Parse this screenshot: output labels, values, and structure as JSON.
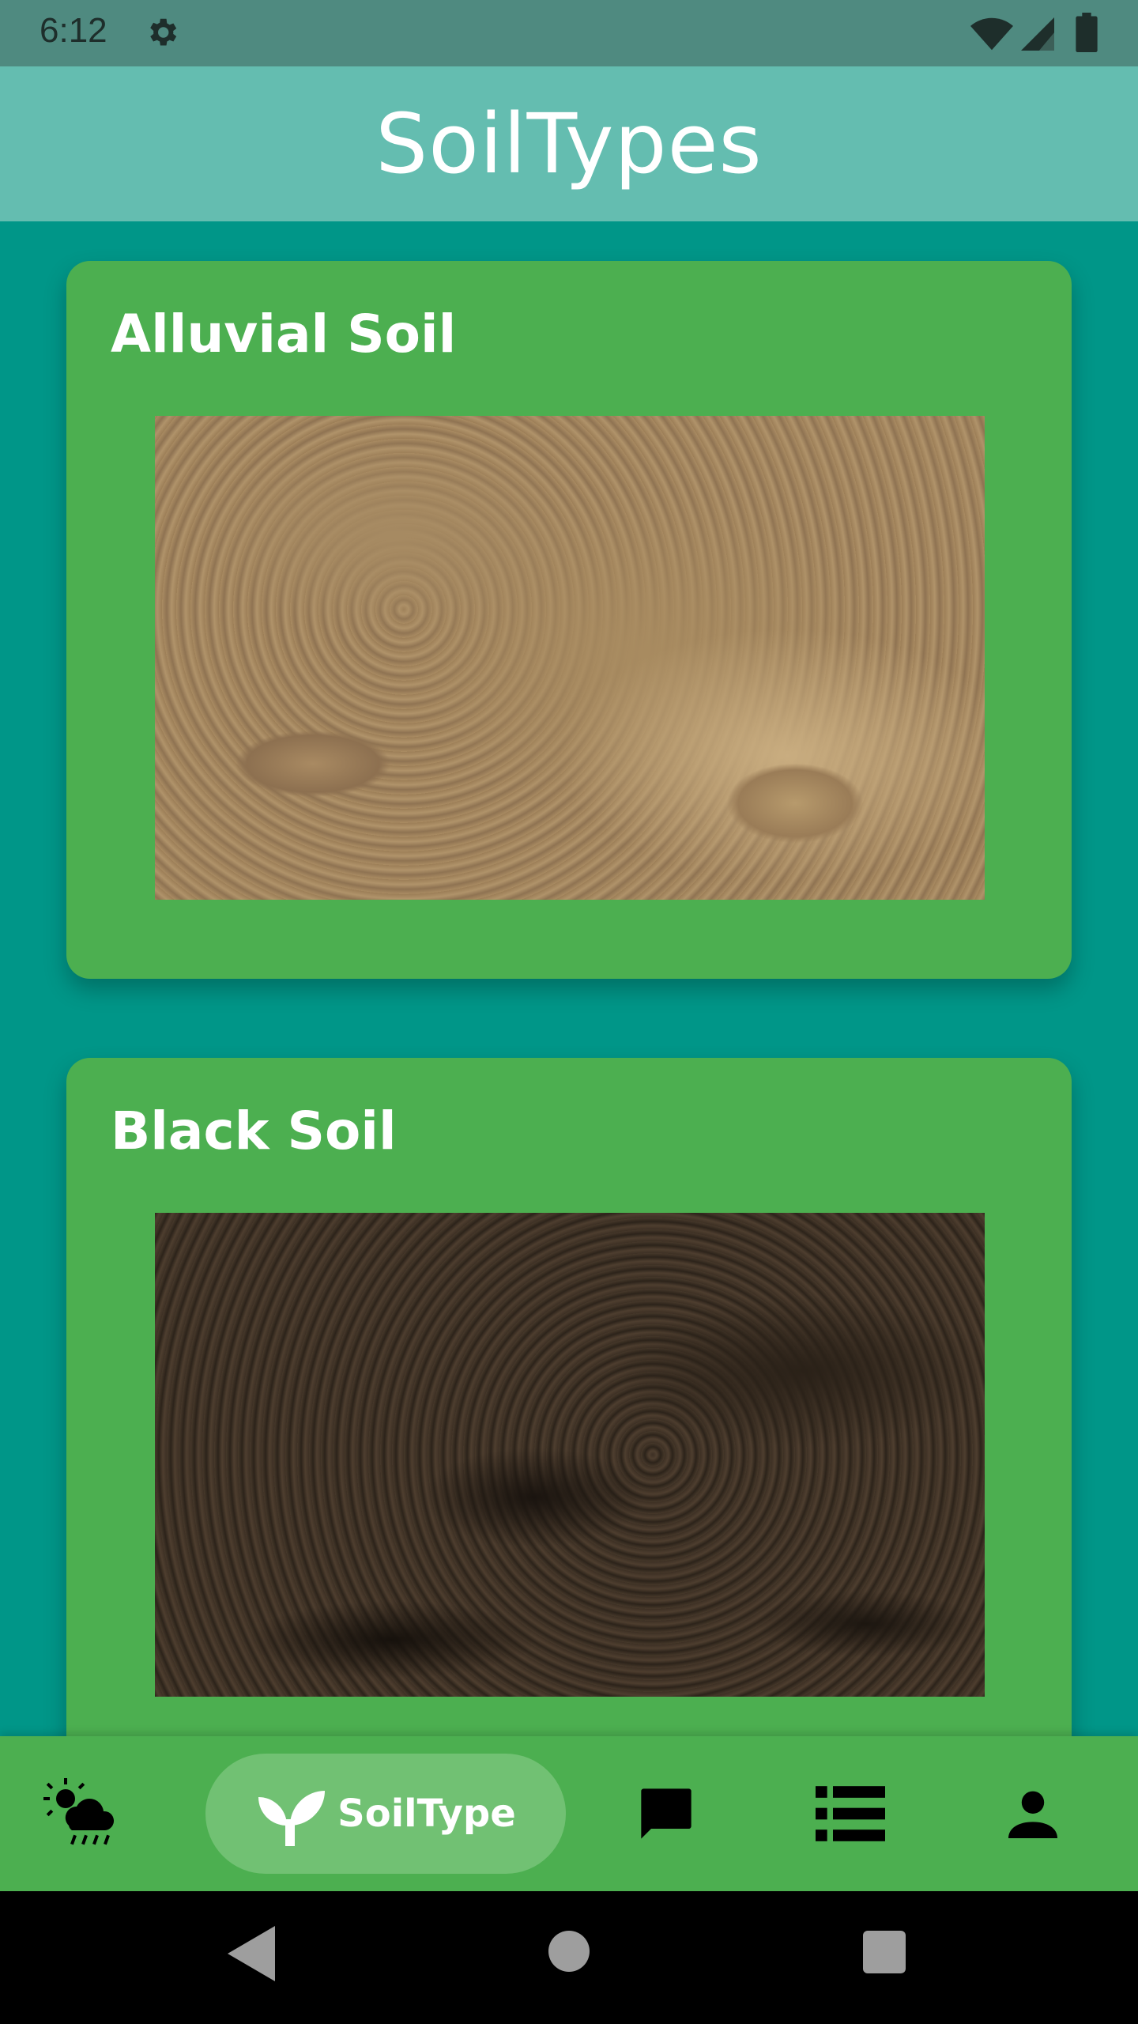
{
  "status_bar": {
    "time": "6:12",
    "icons": [
      "gear-icon",
      "wifi-icon",
      "signal-icon",
      "battery-icon"
    ]
  },
  "app_bar": {
    "title": "SoilTypes"
  },
  "cards": [
    {
      "title": "Alluvial Soil",
      "image": "alluvial-soil-photo"
    },
    {
      "title": "Black Soil",
      "image": "black-soil-photo"
    }
  ],
  "bottom_nav": {
    "items": [
      {
        "icon": "weather-icon",
        "label": ""
      },
      {
        "icon": "sprout-icon",
        "label": "SoilType",
        "selected": true
      },
      {
        "icon": "chat-icon",
        "label": ""
      },
      {
        "icon": "list-icon",
        "label": ""
      },
      {
        "icon": "person-icon",
        "label": ""
      }
    ]
  },
  "colors": {
    "background": "#009688",
    "app_bar": "#64bdb0",
    "card": "#4caf50",
    "nav_selected": "#71c173"
  }
}
